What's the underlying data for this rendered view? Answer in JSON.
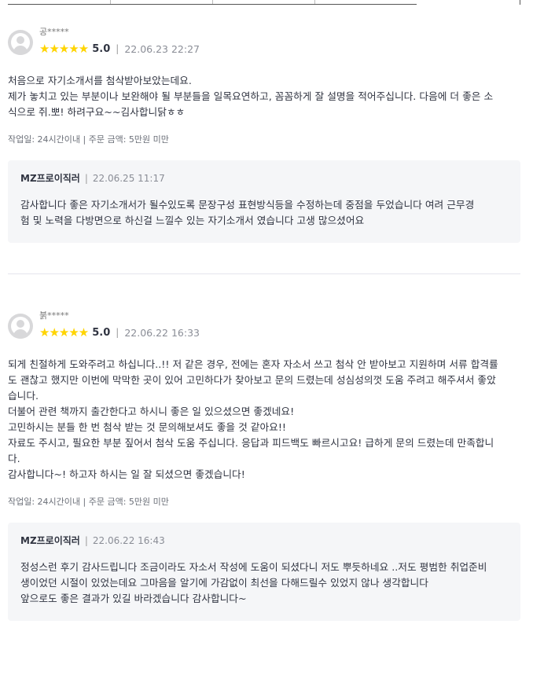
{
  "reviews": [
    {
      "username": "공*****",
      "stars": "★★★★★",
      "score": "5.0",
      "date": "22.06.23 22:27",
      "lines": [
        "처음으로  자기소개서를  첨삭받아보았는데요.",
        "제가 놓치고 있는 부분이나 보완해야 될 부분들을 일목요연하고, 꼼꼼하게 잘 설명을 적어주십니다. 다음에 더 좋은 소",
        "식으로 쥐.뽀! 하려구요~~김사합니닭ㅎㅎ"
      ],
      "work_info": "작업일: 24시간이내 | 주문 금액: 5만원 미만",
      "reply": {
        "author": "MZ프로이직러",
        "date": "22.06.25 11:17",
        "lines": [
          "감사합니다 좋은  자기소개서가 될수있도록 문장구성 표현방식등을 수정하는데 중점을 두었습니다 여려 근무경",
          "험 및 노력을 다방면으로 하신걸 느낄수 있는 자기소개서 였습니다 고생 많으셨어요"
        ]
      }
    },
    {
      "username": "붉*****",
      "stars": "★★★★★",
      "score": "5.0",
      "date": "22.06.22 16:33",
      "lines": [
        "되게 친절하게 도와주려고 하십니다..!! 저 같은 경우, 전에는 혼자 자소서 쓰고 첨삭 안 받아보고 지원하며 서류 합격률",
        "도 괜찮고 했지만 이번에 막막한 곳이 있어 고민하다가 찾아보고 문의 드렸는데 성심성의껏 도움 주려고 해주셔서 좋았",
        "습니다.",
        "더불어 관련 책까지 출간한다고 하시니 좋은 일 있으셨으면 좋겠네요!",
        "고민하시는 분들 한 번 첨삭 받는 것 문의해보셔도 좋을 것 같아요!!",
        "자료도 주시고, 필요한 부분 짚어서 첨삭 도움 주십니다. 응답과 피드백도 빠르시고요! 급하게 문의 드렸는데 만족합니",
        "다.",
        "감사합니다~! 하고자 하시는 일 잘 되셨으면 좋겠습니다!"
      ],
      "work_info": "작업일: 24시간이내 | 주문 금액: 5만원 미만",
      "reply": {
        "author": "MZ프로이직러",
        "date": "22.06.22 16:43",
        "lines": [
          "정성스런 후기 감사드립니다 조금이라도 자소서 작성에 도움이 되셨다니 저도 뿌듯하네요 ..저도 평범한 취업준비",
          "생이었던 시절이 있었는데요 그마음을 알기에 가감없이 최선을 다해드릴수 있었지 않나 생각합니다",
          "앞으로도 좋은 결과가 있길 바라겠습니다 감사합니다~"
        ]
      }
    }
  ],
  "colors": {
    "star": "#FFD400",
    "reply_bg": "#f5f6f8",
    "text": "#303441"
  }
}
